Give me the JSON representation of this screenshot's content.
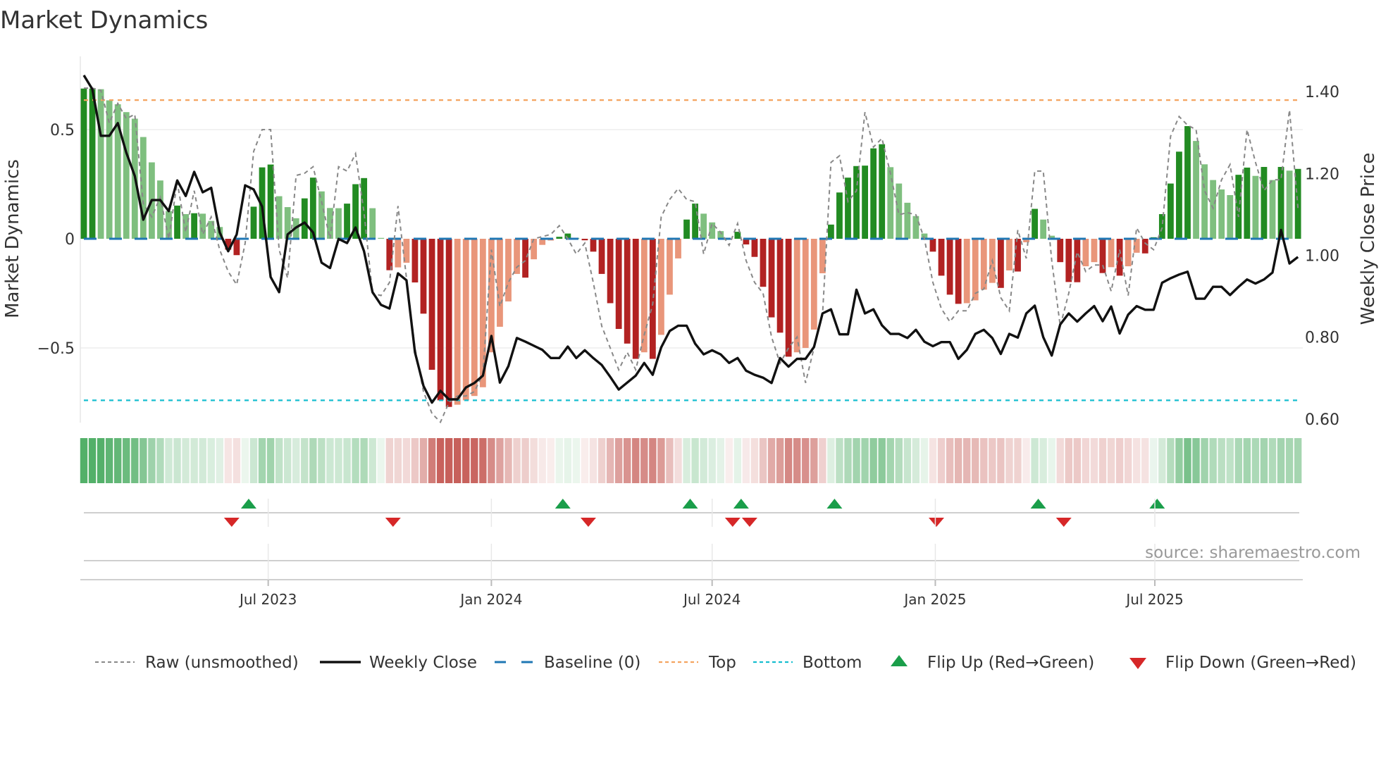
{
  "chart_data": {
    "type": "bar",
    "title": "Market Dynamics",
    "ylabel_left": "Market Dynamics",
    "ylabel_right": "Weekly Close Price",
    "source": "source: sharemaestro.com",
    "start_date": "2023-01-30",
    "frequency": "weekly",
    "ylim_left": [
      -0.86,
      0.83
    ],
    "ylim_right": [
      0.59,
      1.46
    ],
    "left_ticks": [
      {
        "v": 0.5,
        "label": "0.5"
      },
      {
        "v": 0,
        "label": "0"
      },
      {
        "v": -0.5,
        "label": "−0.5"
      }
    ],
    "right_ticks": [
      {
        "v": 1.4,
        "label": "1.40"
      },
      {
        "v": 1.2,
        "label": "1.20"
      },
      {
        "v": 1.0,
        "label": "1.00"
      },
      {
        "v": 0.8,
        "label": "0.80"
      },
      {
        "v": 0.6,
        "label": "0.60"
      }
    ],
    "x_ticks": [
      {
        "date": "2023-07-01",
        "label": "Jul 2023"
      },
      {
        "date": "2024-01-01",
        "label": "Jan 2024"
      },
      {
        "date": "2024-07-01",
        "label": "Jul 2024"
      },
      {
        "date": "2025-01-01",
        "label": "Jan 2025"
      },
      {
        "date": "2025-07-01",
        "label": "Jul 2025"
      }
    ],
    "top_level": 0.635,
    "bottom_level": -0.74,
    "baseline": 0,
    "colors": {
      "up_strong": "#228b22",
      "up_weak": "#7fbf7f",
      "down_strong": "#b22222",
      "down_weak": "#e9967a",
      "baseline": "#1f77b4",
      "top": "#f4a460",
      "bottom": "#17becf",
      "flip_up": "#1a9e4a",
      "flip_down": "#d62728",
      "close": "#111111",
      "raw": "#888888"
    },
    "series": [
      {
        "name": "Market Dynamics",
        "values": [
          0.688,
          0.688,
          0.685,
          0.634,
          0.616,
          0.58,
          0.55,
          0.466,
          0.35,
          0.267,
          0.127,
          0.152,
          0.113,
          0.117,
          0.115,
          0.082,
          0.054,
          -0.05,
          -0.075,
          0.004,
          0.147,
          0.327,
          0.34,
          0.195,
          0.145,
          0.094,
          0.185,
          0.28,
          0.217,
          0.141,
          0.14,
          0.161,
          0.25,
          0.278,
          0.14,
          0.004,
          -0.144,
          -0.131,
          -0.11,
          -0.2,
          -0.343,
          -0.6,
          -0.74,
          -0.77,
          -0.76,
          -0.74,
          -0.72,
          -0.68,
          -0.52,
          -0.403,
          -0.287,
          -0.161,
          -0.178,
          -0.094,
          -0.028,
          -0.008,
          0.009,
          0.024,
          0.004,
          -0.007,
          -0.059,
          -0.161,
          -0.295,
          -0.413,
          -0.48,
          -0.55,
          -0.52,
          -0.55,
          -0.44,
          -0.256,
          -0.09,
          0.088,
          0.161,
          0.115,
          0.075,
          0.035,
          -0.003,
          0.032,
          -0.026,
          -0.083,
          -0.22,
          -0.36,
          -0.43,
          -0.54,
          -0.52,
          -0.5,
          -0.416,
          -0.158,
          0.065,
          0.212,
          0.28,
          0.333,
          0.335,
          0.414,
          0.433,
          0.328,
          0.253,
          0.165,
          0.104,
          0.024,
          -0.059,
          -0.169,
          -0.256,
          -0.298,
          -0.295,
          -0.282,
          -0.233,
          -0.202,
          -0.225,
          -0.145,
          -0.15,
          -0.016,
          0.137,
          0.088,
          0.014,
          -0.107,
          -0.198,
          -0.199,
          -0.126,
          -0.107,
          -0.157,
          -0.13,
          -0.169,
          -0.126,
          -0.064,
          -0.067,
          0.007,
          0.113,
          0.253,
          0.399,
          0.516,
          0.448,
          0.341,
          0.269,
          0.226,
          0.2,
          0.293,
          0.326,
          0.288,
          0.329,
          0.269,
          0.329,
          0.312,
          0.32
        ]
      },
      {
        "name": "Raw (unsmoothed)",
        "values": [
          0.69,
          0.69,
          0.68,
          0.53,
          0.62,
          0.55,
          0.57,
          0.16,
          0.1,
          0.19,
          0.0,
          0.26,
          0.03,
          0.22,
          0.02,
          0.1,
          -0.05,
          -0.15,
          -0.21,
          -0.02,
          0.4,
          0.5,
          0.5,
          -0.05,
          -0.18,
          0.29,
          0.3,
          0.33,
          0.17,
          0.0,
          0.33,
          0.31,
          0.39,
          0.12,
          -0.25,
          -0.26,
          -0.2,
          0.15,
          -0.18,
          -0.5,
          -0.7,
          -0.8,
          -0.84,
          -0.75,
          -0.72,
          -0.72,
          -0.7,
          -0.62,
          -0.05,
          -0.31,
          -0.2,
          -0.13,
          -0.1,
          0,
          0.01,
          0.02,
          0.06,
          0,
          -0.07,
          -0.02,
          -0.2,
          -0.4,
          -0.5,
          -0.6,
          -0.52,
          -0.6,
          -0.44,
          -0.3,
          0.1,
          0.18,
          0.23,
          0.18,
          0.17,
          -0.07,
          0.07,
          0.03,
          -0.03,
          0.07,
          -0.1,
          -0.2,
          -0.25,
          -0.45,
          -0.57,
          -0.5,
          -0.45,
          -0.66,
          -0.5,
          -0.35,
          0.35,
          0.38,
          0.17,
          0.22,
          0.58,
          0.42,
          0.46,
          0.3,
          0.11,
          0.12,
          0.11,
          0,
          -0.2,
          -0.32,
          -0.38,
          -0.33,
          -0.33,
          -0.25,
          -0.23,
          -0.1,
          -0.27,
          -0.33,
          0.04,
          -0.09,
          0.31,
          0.31,
          -0.1,
          -0.4,
          -0.25,
          -0.06,
          -0.15,
          -0.12,
          -0.12,
          -0.24,
          -0.05,
          -0.26,
          0.05,
          -0.02,
          -0.05,
          0.05,
          0.47,
          0.56,
          0.52,
          0.5,
          0.22,
          0.14,
          0.27,
          0.34,
          0.1,
          0.5,
          0.35,
          0.22,
          0.27,
          0.27,
          0.59,
          0.14
        ]
      },
      {
        "name": "Weekly Close",
        "axis": "right",
        "values": [
          1.44,
          1.406,
          1.292,
          1.292,
          1.323,
          1.251,
          1.194,
          1.087,
          1.135,
          1.135,
          1.108,
          1.183,
          1.145,
          1.204,
          1.154,
          1.165,
          1.056,
          1.01,
          1.051,
          1.171,
          1.161,
          1.119,
          0.947,
          0.91,
          1.051,
          1.068,
          1.08,
          1.056,
          0.982,
          0.969,
          1.04,
          1.03,
          1.068,
          1.01,
          0.91,
          0.879,
          0.87,
          0.956,
          0.939,
          0.763,
          0.681,
          0.64,
          0.669,
          0.648,
          0.648,
          0.677,
          0.688,
          0.706,
          0.803,
          0.689,
          0.729,
          0.798,
          0.789,
          0.779,
          0.769,
          0.749,
          0.749,
          0.777,
          0.749,
          0.768,
          0.749,
          0.732,
          0.703,
          0.672,
          0.689,
          0.706,
          0.737,
          0.708,
          0.775,
          0.815,
          0.828,
          0.828,
          0.784,
          0.758,
          0.768,
          0.758,
          0.737,
          0.749,
          0.718,
          0.708,
          0.701,
          0.688,
          0.749,
          0.728,
          0.747,
          0.747,
          0.776,
          0.858,
          0.868,
          0.807,
          0.807,
          0.916,
          0.858,
          0.868,
          0.829,
          0.808,
          0.808,
          0.798,
          0.818,
          0.789,
          0.778,
          0.788,
          0.788,
          0.747,
          0.769,
          0.808,
          0.818,
          0.798,
          0.759,
          0.808,
          0.799,
          0.858,
          0.877,
          0.8,
          0.755,
          0.831,
          0.858,
          0.838,
          0.858,
          0.876,
          0.839,
          0.875,
          0.809,
          0.855,
          0.876,
          0.867,
          0.867,
          0.933,
          0.944,
          0.953,
          0.96,
          0.894,
          0.894,
          0.923,
          0.923,
          0.903,
          0.923,
          0.941,
          0.931,
          0.941,
          0.958,
          1.062,
          0.98,
          0.996
        ]
      }
    ],
    "legend_position": "bottom",
    "legend": [
      {
        "key": "raw",
        "label": "Raw (unsmoothed)"
      },
      {
        "key": "close",
        "label": "Weekly Close"
      },
      {
        "key": "baseline",
        "label": "Baseline (0)"
      },
      {
        "key": "top",
        "label": "Top"
      },
      {
        "key": "bottom",
        "label": "Bottom"
      },
      {
        "key": "flip_up",
        "label": "Flip Up (Red→Green)"
      },
      {
        "key": "flip_down",
        "label": "Flip Down (Green→Red)"
      }
    ]
  }
}
